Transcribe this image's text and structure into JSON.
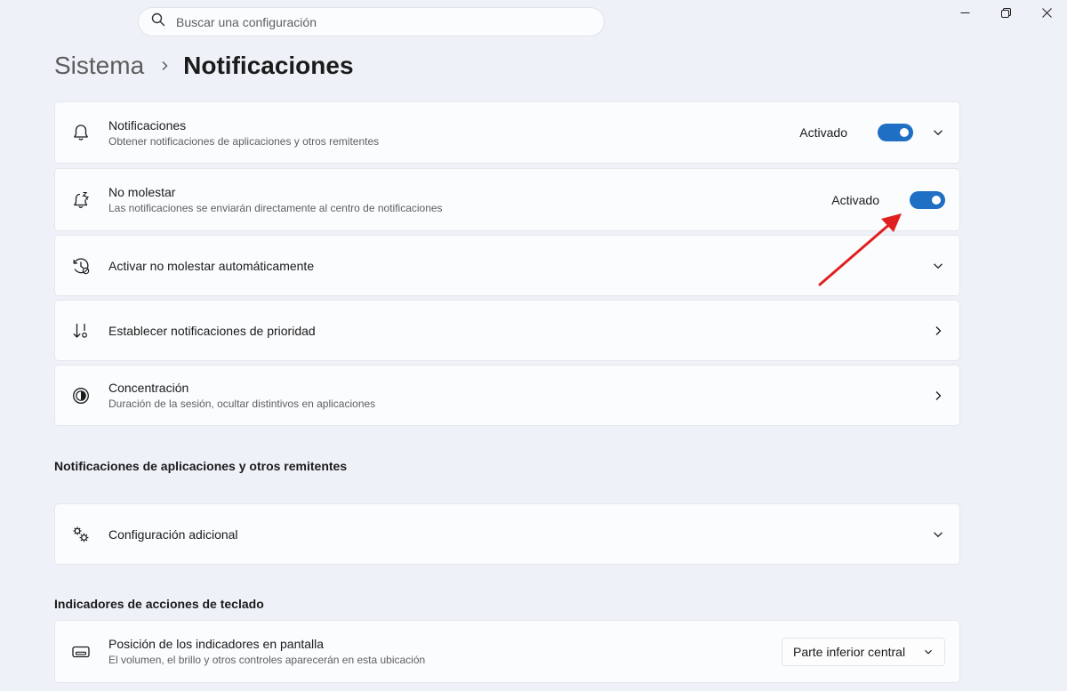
{
  "search": {
    "placeholder": "Buscar una configuración"
  },
  "breadcrumb": {
    "parent": "Sistema",
    "current": "Notificaciones"
  },
  "cards": {
    "notifications": {
      "title": "Notificaciones",
      "subtitle": "Obtener notificaciones de aplicaciones y otros remitentes",
      "state": "Activado",
      "toggle_on": true
    },
    "dnd": {
      "title": "No molestar",
      "subtitle": "Las notificaciones se enviarán directamente al centro de notificaciones",
      "state": "Activado",
      "toggle_on": true
    },
    "auto_dnd": {
      "title": "Activar no molestar automáticamente"
    },
    "priority": {
      "title": "Establecer notificaciones de prioridad"
    },
    "focus": {
      "title": "Concentración",
      "subtitle": "Duración de la sesión, ocultar distintivos en aplicaciones"
    },
    "additional": {
      "title": "Configuración adicional"
    },
    "position": {
      "title": "Posición de los indicadores en pantalla",
      "subtitle": "El volumen, el brillo y otros controles aparecerán en esta ubicación",
      "selected": "Parte inferior central"
    }
  },
  "sections": {
    "apps": "Notificaciones de aplicaciones y otros remitentes",
    "keyboard": "Indicadores de acciones de teclado"
  },
  "colors": {
    "accent": "#1f6fc5",
    "annotation": "#e02020"
  },
  "icons": {
    "window_controls": [
      "minimize-icon",
      "restore-icon",
      "close-icon"
    ]
  }
}
